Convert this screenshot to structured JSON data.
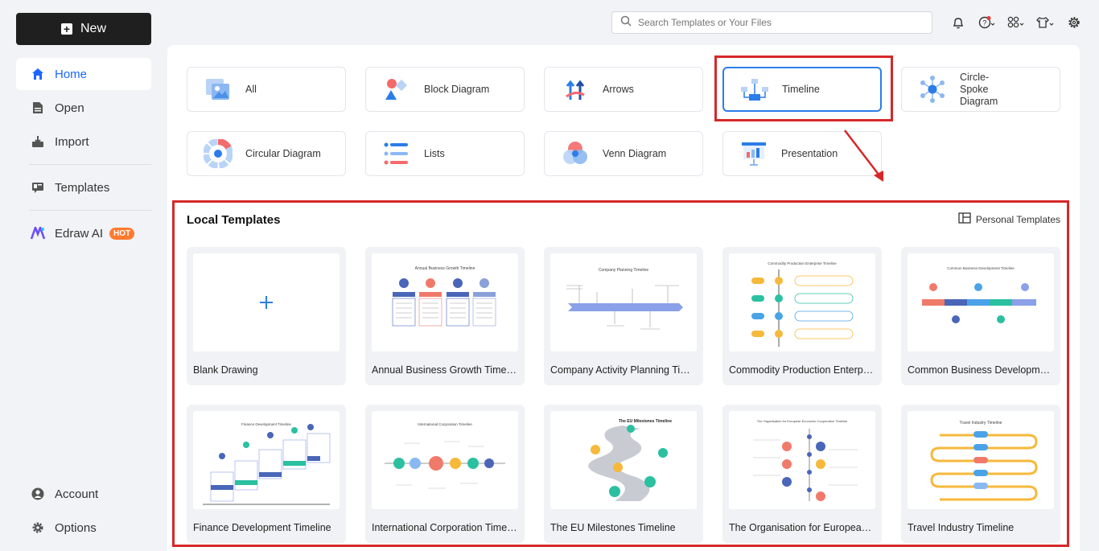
{
  "sidebar": {
    "new_label": "New",
    "items": [
      {
        "label": "Home",
        "icon": "home-icon"
      },
      {
        "label": "Open",
        "icon": "open-file-icon"
      },
      {
        "label": "Import",
        "icon": "import-icon"
      },
      {
        "label": "Templates",
        "icon": "templates-icon"
      },
      {
        "label": "Edraw AI",
        "icon": "edraw-ai-icon",
        "badge": "HOT"
      }
    ],
    "bottom_items": [
      {
        "label": "Account",
        "icon": "account-icon"
      },
      {
        "label": "Options",
        "icon": "gear-icon"
      }
    ]
  },
  "topbar": {
    "search_placeholder": "Search Templates or Your Files",
    "icons": [
      "bell-icon",
      "help-icon",
      "apps-icon",
      "shirt-icon",
      "settings-icon"
    ]
  },
  "categories": [
    {
      "label": "All"
    },
    {
      "label": "Block Diagram"
    },
    {
      "label": "Arrows"
    },
    {
      "label": "Timeline",
      "selected": true
    },
    {
      "label": "Circle-Spoke Diagram"
    },
    {
      "label": "Circular Diagram"
    },
    {
      "label": "Lists"
    },
    {
      "label": "Venn Diagram"
    },
    {
      "label": "Presentation"
    }
  ],
  "local_templates": {
    "title": "Local Templates",
    "personal_label": "Personal Templates",
    "items": [
      {
        "title": "Blank Drawing"
      },
      {
        "title": "Annual Business Growth Timeline",
        "thumb_title": "Annual Business Growth Timeline"
      },
      {
        "title": "Company Activity Planning Tim...",
        "thumb_title": "Company Planning Timeline"
      },
      {
        "title": "Commodity Production Enterpri...",
        "thumb_title": "Commodity Production Enterprise Timeline"
      },
      {
        "title": "Common Business Developmen...",
        "thumb_title": "Common Business Development Timeline"
      },
      {
        "title": "Finance Development Timeline",
        "thumb_title": "Finance Development Timeline"
      },
      {
        "title": "International Corporation Timeline",
        "thumb_title": "International Corporation Timeline"
      },
      {
        "title": "The EU Milestones Timeline",
        "thumb_title": "The EU Milestones Timeline"
      },
      {
        "title": "The Organisation for European E...",
        "thumb_title": "The Organisation for European Economic Cooperation Timeline"
      },
      {
        "title": "Travel Industry Timeline",
        "thumb_title": "Travel Industry Timeline"
      }
    ]
  },
  "colors": {
    "accent": "#2b7de9",
    "highlight_red": "#d62828",
    "dark_button": "#1f1f1f"
  }
}
